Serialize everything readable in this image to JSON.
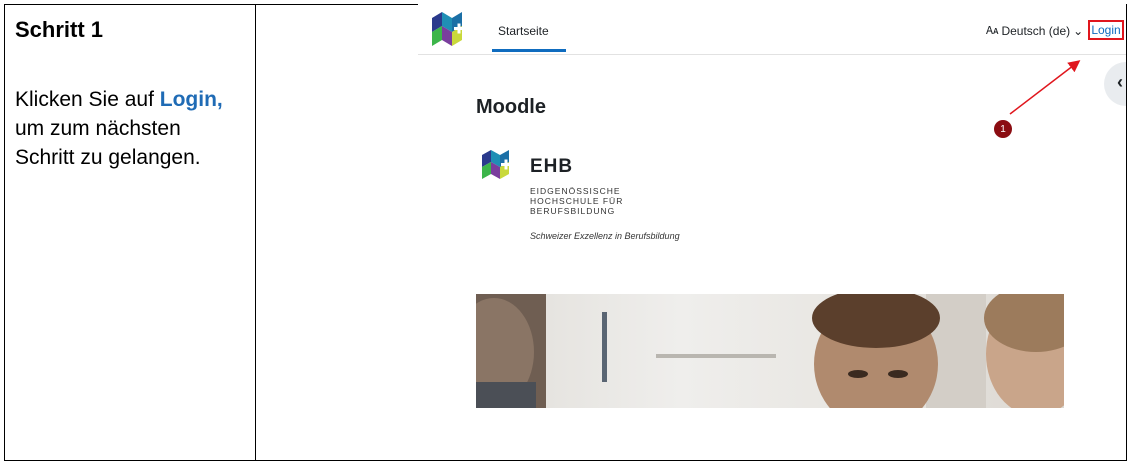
{
  "left_column": {
    "step_title": "Schritt 1",
    "instruction_before": "Klicken Sie auf ",
    "instruction_link": "Login,",
    "instruction_after": " um zum nächsten Schritt zu gelangen."
  },
  "screenshot": {
    "nav": {
      "tab_label": "Startseite",
      "language_label": "Deutsch (de)",
      "language_caret": "⌄",
      "login_label": "Login",
      "drawer_icon": "chevron-left-icon"
    },
    "page_heading": "Moodle",
    "ehb": {
      "name": "EHB",
      "line1": "EIDGENÖSSISCHE",
      "line2": "HOCHSCHULE FÜR",
      "line3": "BERUFSBILDUNG",
      "tagline": "Schweizer Exzellenz in Berufsbildung"
    },
    "callout_number": "1",
    "colors": {
      "accent": "#0f6cbf",
      "highlight": "#e0161d",
      "badge": "#8b0d12",
      "instruction_link": "#1f6bb5"
    }
  }
}
